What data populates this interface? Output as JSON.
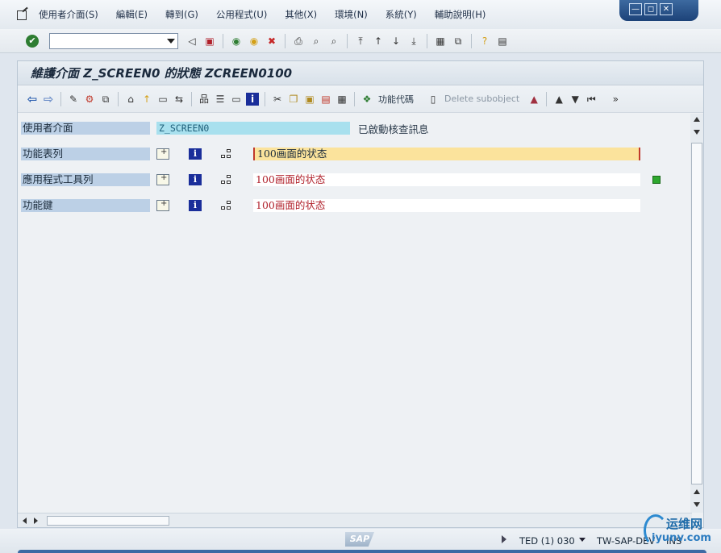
{
  "menu": {
    "items": [
      "使用者介面(S)",
      "編輯(E)",
      "轉到(G)",
      "公用程式(U)",
      "其他(X)",
      "環境(N)",
      "系統(Y)",
      "輔助說明(H)"
    ]
  },
  "window_controls": {
    "minimize": "—",
    "restore": "◻",
    "close": "✕"
  },
  "command_field": {
    "value": ""
  },
  "title": "維護介面 Z_SCREEN0 的狀態 ZCREEN0100",
  "app_toolbar": {
    "function_code_label": "功能代碼",
    "delete_subobject_label": "Delete subobject"
  },
  "form": {
    "interface_label": "使用者介面",
    "interface_value": "Z_SCREEN0",
    "check_status": "已啟動核查訊息",
    "rows": [
      {
        "label": "功能表列",
        "value": "100画面的状态"
      },
      {
        "label": "應用程式工具列",
        "value": "100画面的状态"
      },
      {
        "label": "功能鍵",
        "value": "100画面的状态"
      }
    ]
  },
  "statusbar": {
    "logo": "SAP",
    "system": "TED (1) 030",
    "server": "TW-SAP-DEV",
    "mode": "INS"
  },
  "watermark": {
    "line1": "运维网",
    "line2": "iyunv.com"
  }
}
